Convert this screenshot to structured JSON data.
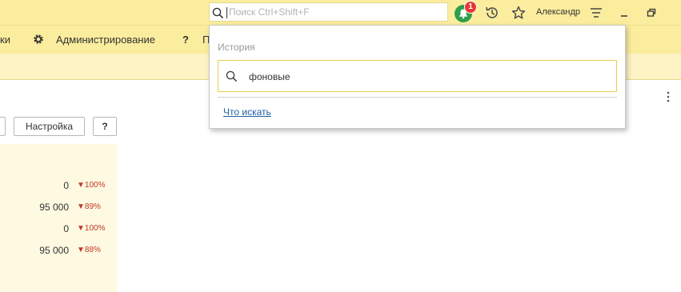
{
  "search": {
    "placeholder": "Поиск Ctrl+Shift+F",
    "icon": "search-icon"
  },
  "notifications": {
    "badge_count": "1",
    "color": "#2e9e4f",
    "badge_color": "#e53935"
  },
  "topbar": {
    "user_name": "Александр",
    "background": "#fbed9e"
  },
  "menu": {
    "items": [
      {
        "label": "ки"
      },
      {
        "label": "Администрирование",
        "icon": "gear-icon"
      },
      {
        "label": "?"
      },
      {
        "label": "П"
      }
    ]
  },
  "toolbar": {
    "settings_label": "Настройка",
    "help_label": "?"
  },
  "data_rows": [
    {
      "value": "0",
      "change": "▼100%"
    },
    {
      "value": "95 000",
      "change": "▼89%"
    },
    {
      "value": "0",
      "change": "▼100%"
    },
    {
      "value": "95 000",
      "change": "▼88%"
    }
  ],
  "search_dropdown": {
    "history_header": "История",
    "history_items": [
      {
        "label": "фоновые"
      }
    ],
    "help_link": "Что искать"
  }
}
